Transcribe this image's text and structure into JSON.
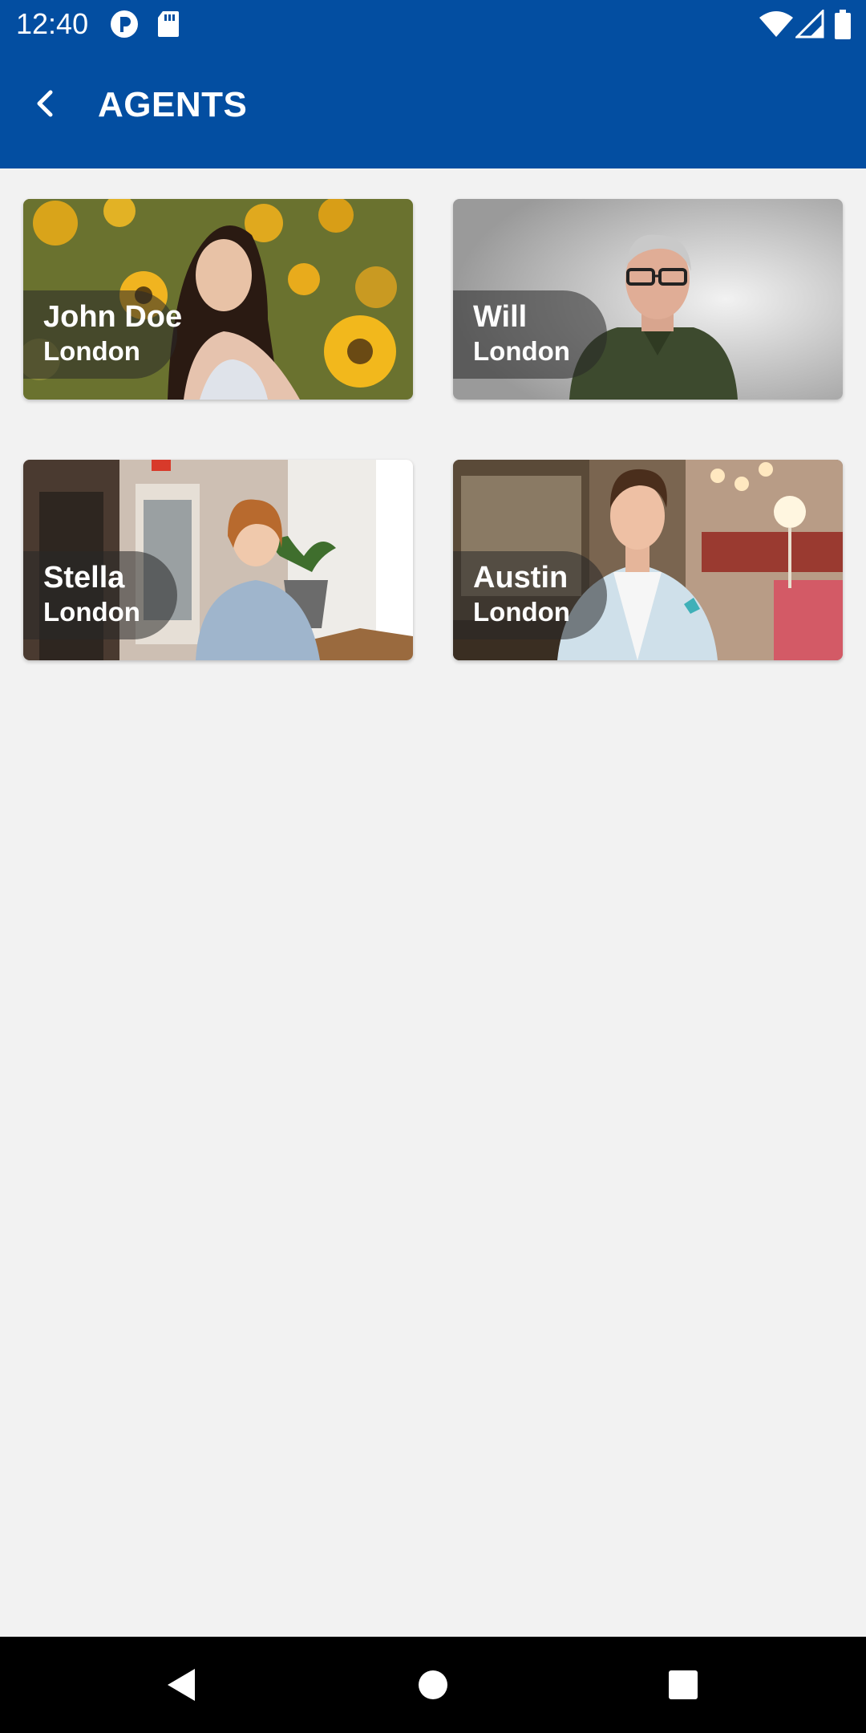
{
  "status_bar": {
    "time": "12:40",
    "icons": [
      "p-app-icon",
      "sd-card-icon",
      "wifi-icon",
      "signal-icon",
      "battery-icon"
    ]
  },
  "app_bar": {
    "title": "AGENTS",
    "back_icon": "back-arrow-icon",
    "color": "#034ea1"
  },
  "agents": [
    {
      "name": "John Doe",
      "city": "London"
    },
    {
      "name": "Will",
      "city": "London"
    },
    {
      "name": "Stella",
      "city": "London"
    },
    {
      "name": "Austin",
      "city": "London"
    }
  ],
  "nav_bar": {
    "buttons": [
      "back-triangle-icon",
      "home-circle-icon",
      "recents-square-icon"
    ]
  }
}
